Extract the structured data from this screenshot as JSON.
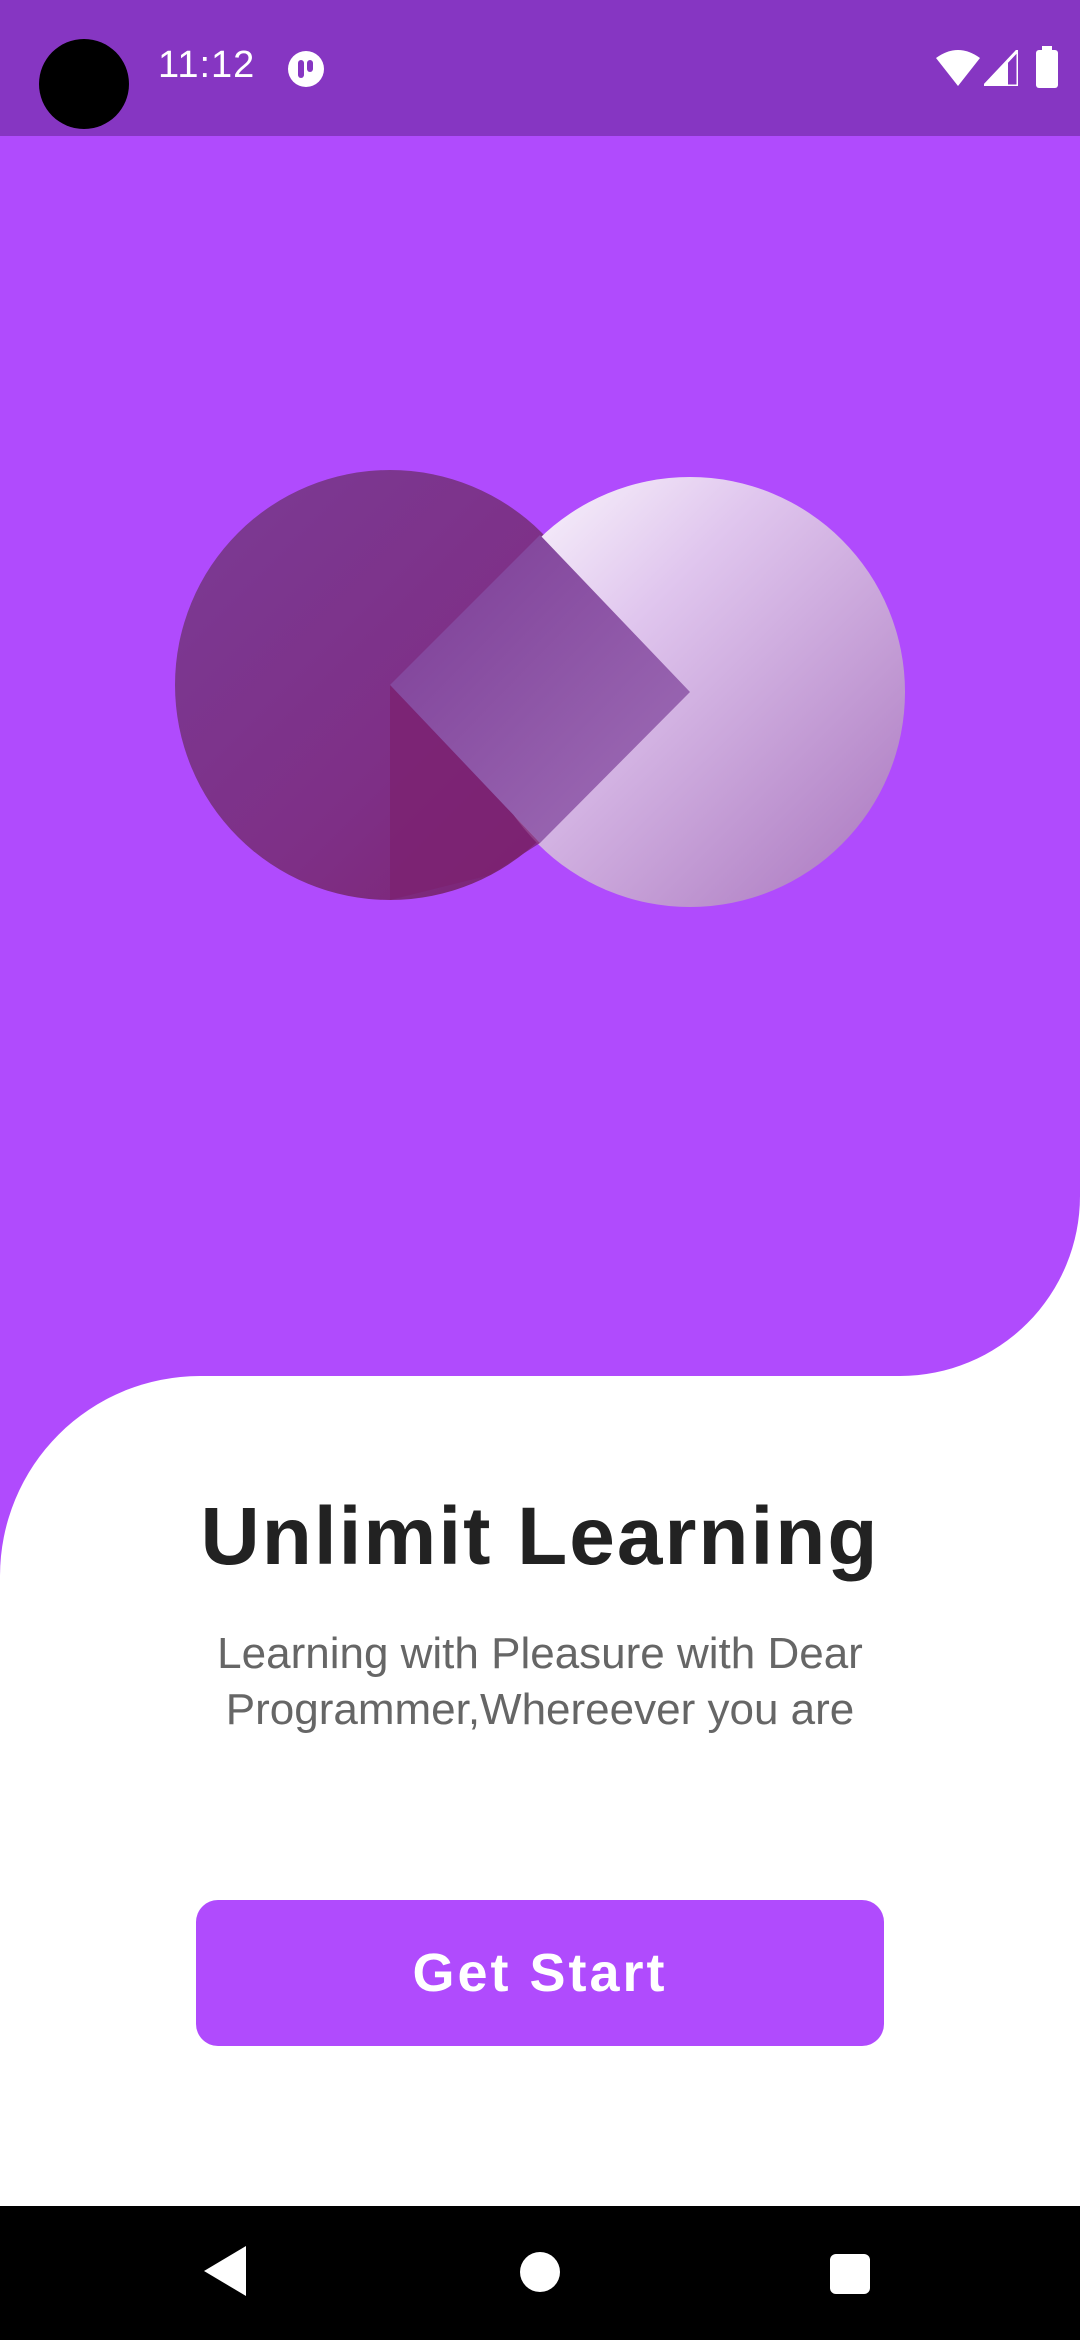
{
  "status_bar": {
    "time": "11:12",
    "background": "#8636c2",
    "icons": [
      "camera-cutout",
      "notification-icon",
      "wifi-icon",
      "signal-icon",
      "battery-icon"
    ]
  },
  "hero": {
    "background": "#b04bfd",
    "logo_icon": "infinity-logo-icon"
  },
  "onboarding": {
    "title": "Unlimit Learning",
    "subtitle_line1": "Learning with Pleasure with Dear",
    "subtitle_line2": "Programmer,Whereever you are",
    "button_label": "Get Start",
    "accent": "#b04bfd"
  },
  "nav_bar": {
    "icons": [
      "back-icon",
      "home-icon",
      "recents-icon"
    ]
  }
}
